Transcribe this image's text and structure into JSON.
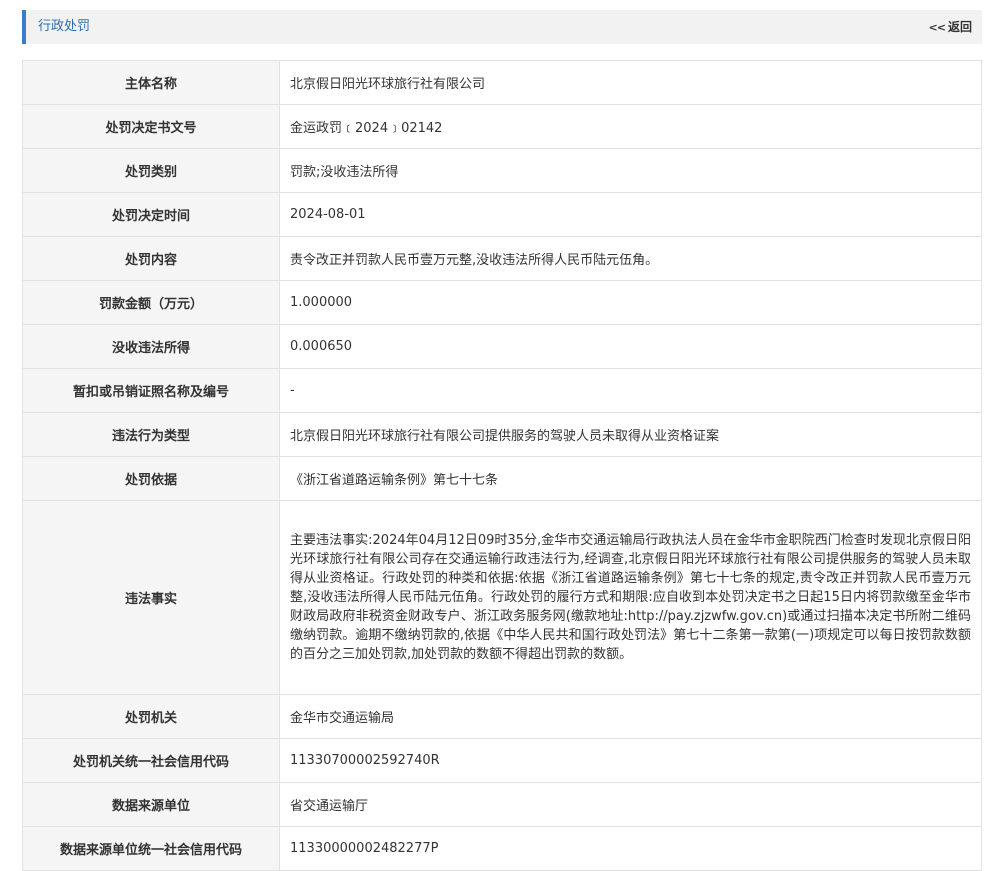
{
  "header": {
    "title": "行政处罚",
    "back_icon": "<<",
    "back_label": "返回"
  },
  "rows": [
    {
      "label": "主体名称",
      "value": "北京假日阳光环球旅行社有限公司"
    },
    {
      "label": "处罚决定书文号",
      "value": "金运政罚﹝2024﹞02142"
    },
    {
      "label": "处罚类别",
      "value": "罚款;没收违法所得"
    },
    {
      "label": "处罚决定时间",
      "value": "2024-08-01"
    },
    {
      "label": "处罚内容",
      "value": "责令改正并罚款人民币壹万元整,没收违法所得人民币陆元伍角。"
    },
    {
      "label": "罚款金额（万元）",
      "value": "1.000000"
    },
    {
      "label": "没收违法所得",
      "value": "0.000650"
    },
    {
      "label": "暂扣或吊销证照名称及编号",
      "value": "-"
    },
    {
      "label": "违法行为类型",
      "value": "北京假日阳光环球旅行社有限公司提供服务的驾驶人员未取得从业资格证案"
    },
    {
      "label": "处罚依据",
      "value": "《浙江省道路运输条例》第七十七条"
    },
    {
      "label": "违法事实",
      "value": "主要违法事实:2024年04月12日09时35分,金华市交通运输局行政执法人员在金华市金职院西门检查时发现北京假日阳光环球旅行社有限公司存在交通运输行政违法行为,经调查,北京假日阳光环球旅行社有限公司提供服务的驾驶人员未取得从业资格证。行政处罚的种类和依据:依据《浙江省道路运输条例》第七十七条的规定,责令改正并罚款人民币壹万元整,没收违法所得人民币陆元伍角。行政处罚的履行方式和期限:应自收到本处罚决定书之日起15日内将罚款缴至金华市财政局政府非税资金财政专户、浙江政务服务网(缴款地址:http://pay.zjzwfw.gov.cn)或通过扫描本决定书所附二维码缴纳罚款。逾期不缴纳罚款的,依据《中华人民共和国行政处罚法》第七十二条第一款第(一)项规定可以每日按罚款数额的百分之三加处罚款,加处罚款的数额不得超出罚款的数额。"
    },
    {
      "label": "处罚机关",
      "value": "金华市交通运输局"
    },
    {
      "label": "处罚机关统一社会信用代码",
      "value": "11330700002592740R"
    },
    {
      "label": "数据来源单位",
      "value": "省交通运输厅"
    },
    {
      "label": "数据来源单位统一社会信用代码",
      "value": "11330000002482277P"
    }
  ]
}
